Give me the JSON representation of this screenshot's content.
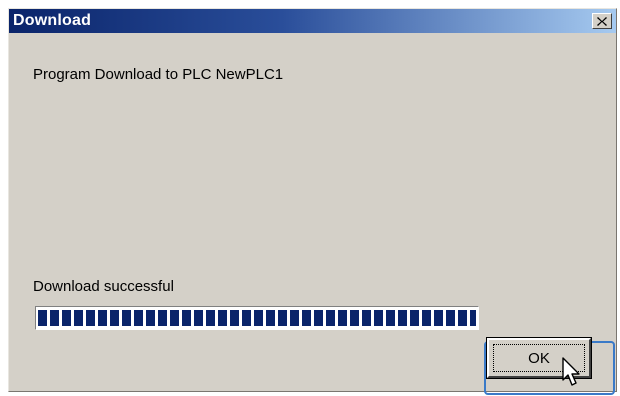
{
  "window": {
    "title": "Download"
  },
  "content": {
    "program_label": "Program Download to PLC NewPLC1",
    "status_label": "Download successful"
  },
  "progress": {
    "value_percent": 100,
    "fill_color": "#0a246a"
  },
  "buttons": {
    "ok_label": "OK",
    "close_icon": "close-icon"
  },
  "colors": {
    "titlebar_start": "#0a246a",
    "titlebar_end": "#a6caf0",
    "window_bg": "#d4d0c8",
    "focus_ring": "#3a7ac8"
  }
}
